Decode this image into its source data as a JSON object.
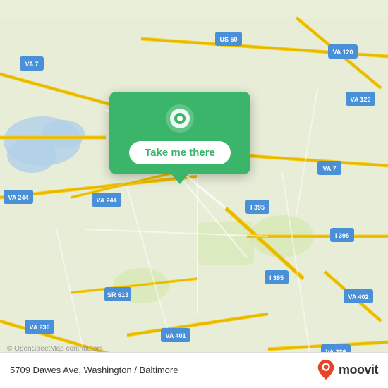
{
  "map": {
    "attribution": "© OpenStreetMap contributors",
    "background_color": "#e8f0d8"
  },
  "popup": {
    "button_label": "Take me there",
    "pin_color": "#ffffff"
  },
  "bottom_bar": {
    "address": "5709 Dawes Ave, Washington / Baltimore"
  },
  "moovit": {
    "logo_text": "moovit"
  }
}
